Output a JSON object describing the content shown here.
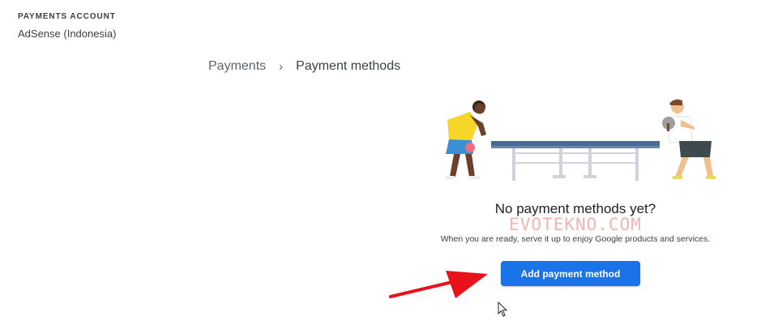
{
  "account": {
    "label": "PAYMENTS ACCOUNT",
    "name": "AdSense (Indonesia)"
  },
  "breadcrumb": {
    "parent": "Payments",
    "separator": "›",
    "current": "Payment methods"
  },
  "empty_state": {
    "title": "No payment methods yet?",
    "subtitle": "When you are ready, serve it up to enjoy Google products and services.",
    "button_label": "Add payment method"
  },
  "watermark": "EVOTEKNO.COM",
  "colors": {
    "primary": "#1a73e8",
    "arrow": "#e8121a",
    "table_top": "#4a6a96"
  },
  "icons": {
    "breadcrumb_separator": "chevron-right-icon",
    "pointer": "mouse-cursor-icon",
    "annotation": "red-arrow"
  }
}
